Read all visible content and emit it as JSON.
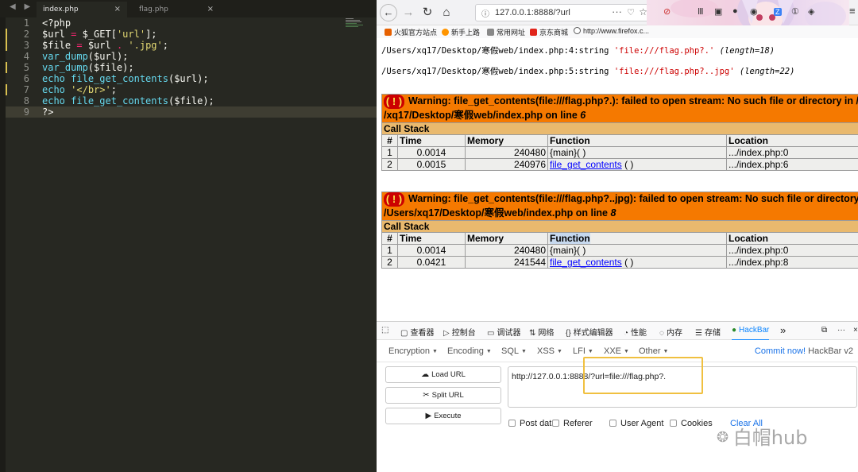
{
  "editor": {
    "tabs": [
      {
        "label": "index.php",
        "close": "×"
      },
      {
        "label": "flag.php",
        "close": "×"
      }
    ],
    "lines": [
      {
        "n": "1",
        "code": "<?php"
      },
      {
        "n": "2",
        "code": "$url = $_GET['url'];"
      },
      {
        "n": "3",
        "code": "$file = $url . '.jpg';"
      },
      {
        "n": "4",
        "code": "var_dump($url);"
      },
      {
        "n": "5",
        "code": "var_dump($file);"
      },
      {
        "n": "6",
        "code": "echo file_get_contents($url);"
      },
      {
        "n": "7",
        "code": "echo '</br>';"
      },
      {
        "n": "8",
        "code": "echo file_get_contents($file);"
      },
      {
        "n": "9",
        "code": "?>"
      }
    ]
  },
  "browser": {
    "url": "127.0.0.1:8888/?url",
    "bookmarks": [
      {
        "label": "火狐官方站点",
        "color": "#e66000"
      },
      {
        "label": "新手上路",
        "color": "#ff9500"
      },
      {
        "label": "常用网址",
        "color": "#888888"
      },
      {
        "label": "京东商城",
        "color": "#e1251b"
      },
      {
        "label": "http://www.firefox.c...",
        "color": "#555555"
      }
    ],
    "dumps": [
      {
        "prefix": "/Users/xq17/Desktop/寒假web/index.php:4:string ",
        "value": "'file:///flag.php?.'",
        "len": " (length=18)"
      },
      {
        "prefix": "/Users/xq17/Desktop/寒假web/index.php:5:string ",
        "value": "'file:///flag.php?..jpg'",
        "len": " (length=22)"
      }
    ],
    "warnings": [
      {
        "bang": "( ! )",
        "line1": "Warning: file_get_contents(file:///flag.php?.): failed to open stream: No such file or directory in /Users",
        "line2": "/xq17/Desktop/寒假web/index.php on line ",
        "line_no": "6",
        "callstack": "Call Stack",
        "headers": [
          "#",
          "Time",
          "Memory",
          "Function",
          "Location"
        ],
        "rows": [
          {
            "n": "1",
            "time": "0.0014",
            "mem": "240480",
            "fn": "{main}( )",
            "link": "",
            "loc": ".../index.php:0"
          },
          {
            "n": "2",
            "time": "0.0015",
            "mem": "240976",
            "fn": " ( )",
            "link": "file_get_contents",
            "loc": ".../index.php:6"
          }
        ]
      },
      {
        "bang": "( ! )",
        "line1": "Warning: file_get_contents(file:///flag.php?..jpg): failed to open stream: No such file or directory in",
        "line2": "/Users/xq17/Desktop/寒假web/index.php on line ",
        "line_no": "8",
        "callstack": "Call Stack",
        "headers": [
          "#",
          "Time",
          "Memory",
          "Function",
          "Location"
        ],
        "rows": [
          {
            "n": "1",
            "time": "0.0014",
            "mem": "240480",
            "fn": "{main}( )",
            "link": "",
            "loc": ".../index.php:0"
          },
          {
            "n": "2",
            "time": "0.0421",
            "mem": "241544",
            "fn": " ( )",
            "link": "file_get_contents",
            "loc": ".../index.php:8"
          }
        ]
      }
    ]
  },
  "devtools": {
    "tabs": [
      "查看器",
      "控制台",
      "调试器",
      "网络",
      "样式编辑器",
      "性能",
      "内存",
      "存储",
      "HackBar"
    ],
    "more": "»"
  },
  "hackbar": {
    "menus": [
      "Encryption",
      "Encoding",
      "SQL",
      "XSS",
      "LFI",
      "XXE",
      "Other"
    ],
    "commit_link": "Commit now!",
    "commit_rest": " HackBar v2",
    "buttons": [
      "Load URL",
      "Split URL",
      "Execute"
    ],
    "url_value": "http://127.0.0.1:8888/?url=file:///flag.php?.",
    "options": [
      "Post data",
      "Referer",
      "User Agent",
      "Cookies"
    ],
    "clear_all": "Clear All"
  },
  "watermark": "白帽hub"
}
